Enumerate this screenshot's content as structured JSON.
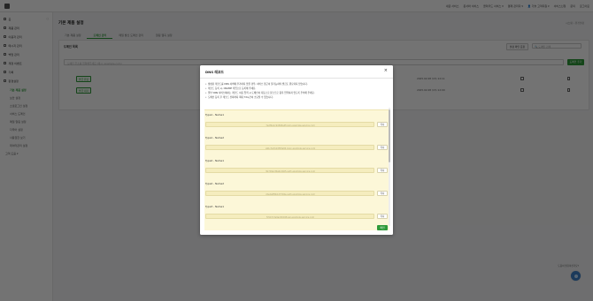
{
  "topbar": {
    "nav": [
      "새글 서비스",
      "문서와 서비스",
      "클라우드 서비스 ▾",
      "결제 관리자 ▾",
      "👤 기술 고객지원 ▾",
      "서비스신청",
      "문의",
      "로그아웃"
    ]
  },
  "sidebar": {
    "items": [
      {
        "label": "홈"
      },
      {
        "label": "제품 관리"
      },
      {
        "label": "이용자 관리"
      },
      {
        "label": "메시지 관리"
      },
      {
        "label": "백업 관리"
      },
      {
        "label": "계정 이벤트"
      },
      {
        "label": "기록"
      },
      {
        "label": "환경설정"
      }
    ],
    "subitems": [
      {
        "label": "기본 제품 설정",
        "active": true
      },
      {
        "label": "보안 설정",
        "active": false
      },
      {
        "label": "소셜로그인 설정",
        "active": false
      },
      {
        "label": "서비스 도메인",
        "active": false
      },
      {
        "label": "메일 알림 설정",
        "active": false
      },
      {
        "label": "다국어 설정",
        "active": false
      },
      {
        "label": "사용권한 보기",
        "active": false
      },
      {
        "label": "데이터관리 설정",
        "active": false
      },
      {
        "label": "외부연결 관리",
        "active": false
      }
    ],
    "footer": "고객 도움 ▾"
  },
  "main": {
    "title": "기본 제품 설정",
    "breadcrumb": "시스템 › 환경설정",
    "tabs": [
      {
        "label": "기본 제품 설정",
        "active": false
      },
      {
        "label": "도메인 관리",
        "active": true
      },
      {
        "label": "메일 발신 도메인 관리",
        "active": false
      },
      {
        "label": "알림 웹훅 설정",
        "active": false
      }
    ],
    "card_title": "도메인 목록",
    "request_button": "설정 확인 요청",
    "search_placeholder": "🔍 도메인 검색",
    "domain_input_placeholder": "도메인 주소를 입력해주세요 (예시: example.com)",
    "add_button": "도메인 추가",
    "rows": [
      {
        "tag": "발급 완료",
        "date": "2025.02.08 (15) 12:11"
      },
      {
        "tag": "발급 대기",
        "date": "2025.02.08 (15) 12:00"
      }
    ],
    "help_text": "도움이 필요하신가요?"
  },
  "modal": {
    "title": "DNS 레코드",
    "notes": [
      "생성된 레코드를 DNS 서버에 추가하지 않을 경우, 서비스 접근이 불가능하며 발급도 완료되지 않습니다.",
      "레코드 등록 시, CNAME 타입으로 등록해 주세요.",
      "일부 DNS 서비스에서는 레코드 이름 입력 시 도메인이 자동으로 붙으므로 중복 입력하지 않도록 주의해 주세요.",
      "도메인 등록 후 레코드 전파까지 최대 72시간이 소요될 수 있습니다."
    ],
    "records": [
      {
        "label": "Type1 - Name1",
        "value": "_7e2f0a1c9d3b8e4f.login.example-service.com",
        "copy": "복사"
      },
      {
        "label": "Type1 - Name2",
        "value": "_a91c3e7b2d5f0a84.login.example-service.com",
        "copy": "복사"
      },
      {
        "label": "Type2 - Name1",
        "value": "_3b7d9e1f4a6c2b05.auth.example-service.com",
        "copy": "복사"
      },
      {
        "label": "Type2 - Name2",
        "value": "_c6e2a8f0b1d7394e.auth.example-service.com",
        "copy": "복사"
      },
      {
        "label": "Type3 - Name1",
        "value": "_5f1b7c3e9a2d6048.api.example-service.com",
        "copy": "복사"
      }
    ],
    "confirm": "확인"
  }
}
